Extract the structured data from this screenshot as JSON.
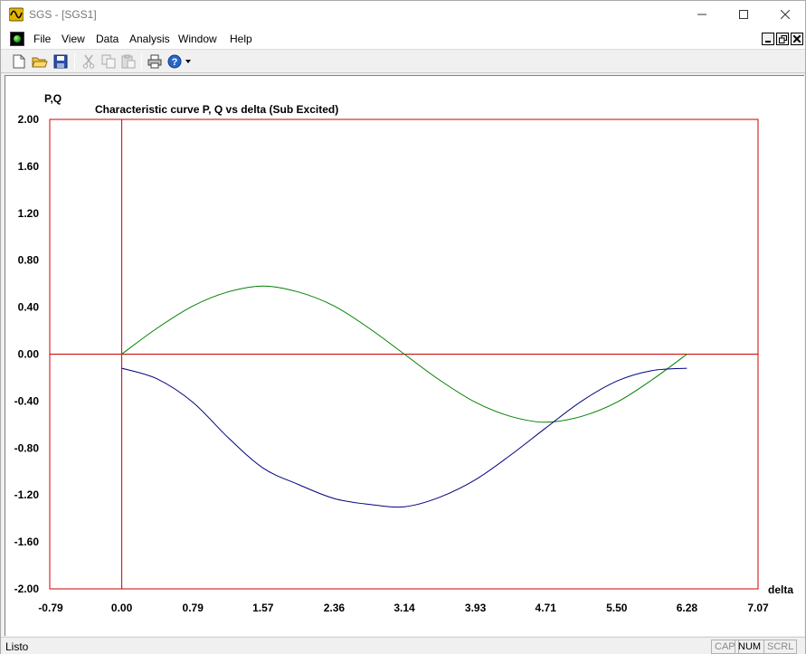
{
  "window": {
    "title": "SGS - [SGS1]"
  },
  "menu": [
    "File",
    "View",
    "Data",
    "Analysis",
    "Window",
    "Help"
  ],
  "toolbar": {
    "buttons": [
      "new-icon",
      "open-icon",
      "save-icon",
      "cut-icon",
      "copy-icon",
      "paste-icon",
      "print-icon",
      "help-icon"
    ]
  },
  "status": {
    "text": "Listo",
    "indicators": [
      {
        "label": "CAP",
        "active": false
      },
      {
        "label": "NUM",
        "active": true
      },
      {
        "label": "SCRL",
        "active": false
      }
    ]
  },
  "colors": {
    "frame": "#cc0000",
    "series_P": "#00007f",
    "series_Q": "#008000"
  },
  "chart_data": {
    "type": "line",
    "title": "Characteristic curve P, Q vs delta (Sub Excited)",
    "xlabel": "delta",
    "ylabel": "P,Q",
    "xlim": [
      -0.79,
      7.07
    ],
    "ylim": [
      -2.0,
      2.0
    ],
    "xticks": [
      "-0.79",
      "0.00",
      "0.79",
      "1.57",
      "2.36",
      "3.14",
      "3.93",
      "4.71",
      "5.50",
      "6.28",
      "7.07"
    ],
    "yticks": [
      "2.00",
      "1.60",
      "1.20",
      "0.80",
      "0.40",
      "0.00",
      "-0.40",
      "-0.80",
      "-1.20",
      "-1.60",
      "-2.00"
    ],
    "grid": false,
    "series": [
      {
        "color": "#008000",
        "x": [
          0.0,
          0.39,
          0.79,
          1.18,
          1.57,
          1.96,
          2.36,
          2.75,
          3.14,
          3.53,
          3.93,
          4.32,
          4.71,
          5.11,
          5.5,
          5.89,
          6.28
        ],
        "y": [
          0.0,
          0.22,
          0.41,
          0.53,
          0.58,
          0.53,
          0.41,
          0.22,
          0.0,
          -0.22,
          -0.41,
          -0.53,
          -0.58,
          -0.53,
          -0.41,
          -0.22,
          0.0
        ]
      },
      {
        "color": "#00007f",
        "x": [
          0.0,
          0.39,
          0.79,
          1.18,
          1.57,
          1.96,
          2.36,
          2.75,
          3.14,
          3.53,
          3.93,
          4.32,
          4.71,
          5.11,
          5.5,
          5.89,
          6.28
        ],
        "y": [
          -0.12,
          -0.21,
          -0.41,
          -0.71,
          -0.97,
          -1.11,
          -1.23,
          -1.28,
          -1.3,
          -1.22,
          -1.07,
          -0.86,
          -0.63,
          -0.4,
          -0.23,
          -0.14,
          -0.12
        ]
      }
    ]
  }
}
